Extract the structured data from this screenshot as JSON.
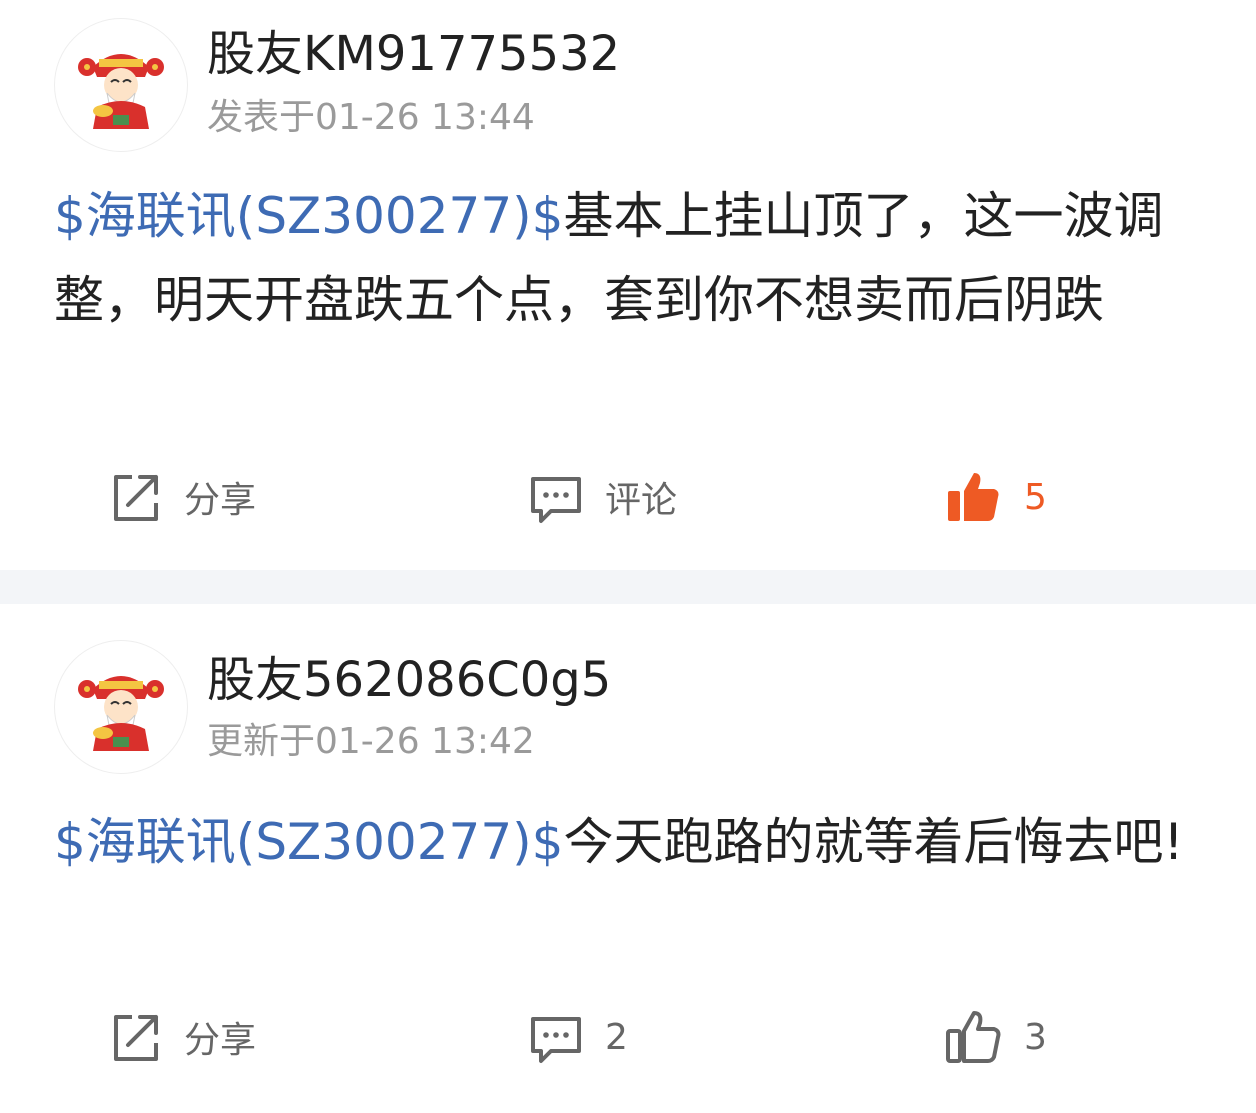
{
  "posts": [
    {
      "username": "股友KM91775532",
      "timestamp": "发表于01-26 13:44",
      "ticker": "$海联讯(SZ300277)$",
      "text": "基本上挂山顶了，这一波调整，明天开盘跌五个点，套到你不想卖而后阴跌",
      "share_label": "分享",
      "comment_label": "评论",
      "like_count": "5",
      "liked": true
    },
    {
      "username": "股友562086C0g5",
      "timestamp": "更新于01-26 13:42",
      "ticker": "$海联讯(SZ300277)$",
      "text": "今天跑路的就等着后悔去吧!",
      "share_label": "分享",
      "comment_label": "2",
      "like_count": "3",
      "liked": false
    }
  ],
  "colors": {
    "ticker": "#3e6bb4",
    "liked": "#ee5a24",
    "icon": "#666666",
    "timestamp": "#9a9a9a",
    "divider": "#f3f5f8"
  },
  "icons": {
    "avatar": "fortune-god-avatar-icon",
    "share": "share-icon",
    "comment": "comment-icon",
    "like_active": "thumbs-up-filled-icon",
    "like": "thumbs-up-outline-icon"
  }
}
